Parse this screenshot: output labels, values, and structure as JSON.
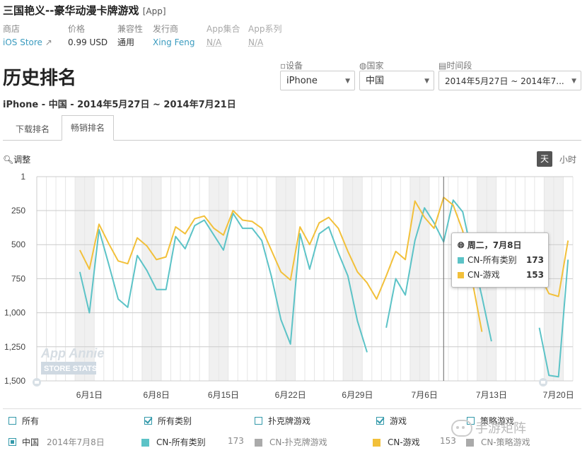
{
  "app": {
    "title": "三国艳义--豪华动漫卡牌游戏",
    "type_tag": "[App]"
  },
  "meta": [
    {
      "key": "商店",
      "value": "iOS Store",
      "link": true,
      "ext": "↗"
    },
    {
      "key": "价格",
      "value": "0.99 USD"
    },
    {
      "key": "兼容性",
      "value": "通用"
    },
    {
      "key": "发行商",
      "value": "Xing Feng",
      "link": true
    },
    {
      "key": "App集合",
      "value": "N/A",
      "na": true
    },
    {
      "key": "App系列",
      "value": "N/A",
      "na": true
    }
  ],
  "page": {
    "heading": "历史排名",
    "subtitle": "iPhone - 中国 - 2014年5月27日 ~ 2014年7月21日"
  },
  "filters": {
    "device": {
      "label": "设备",
      "value": "iPhone"
    },
    "country": {
      "label": "国家",
      "value": "中国"
    },
    "period": {
      "label": "时间段",
      "value": "2014年5月27日 ~ 2014年7..."
    }
  },
  "tabs": [
    {
      "label": "下载排名",
      "active": false
    },
    {
      "label": "畅销排名",
      "active": true
    }
  ],
  "zoom_label": "调整",
  "granularity": {
    "day": "天",
    "hour": "小时"
  },
  "colors": {
    "teal": "#5cc3c7",
    "yellow": "#f2c03a",
    "grid": "#e6e6e6",
    "weekend": "#f0f0f0"
  },
  "watermark_chart": {
    "line1": "App Annie",
    "line2": "STORE STATS"
  },
  "chart_data": {
    "type": "line",
    "y_reversed": true,
    "ylim": [
      1,
      1500
    ],
    "yticks": [
      "1",
      "250",
      "500",
      "750",
      "1,000",
      "1,250",
      "1,500"
    ],
    "x_tick_labels": [
      "6月1日",
      "6月8日",
      "6月15日",
      "6月22日",
      "6月29日",
      "7月6日",
      "7月13日",
      "7月20日"
    ],
    "x": [
      "5/27",
      "5/28",
      "5/29",
      "5/30",
      "5/31",
      "6/1",
      "6/2",
      "6/3",
      "6/4",
      "6/5",
      "6/6",
      "6/7",
      "6/8",
      "6/9",
      "6/10",
      "6/11",
      "6/12",
      "6/13",
      "6/14",
      "6/15",
      "6/16",
      "6/17",
      "6/18",
      "6/19",
      "6/20",
      "6/21",
      "6/22",
      "6/23",
      "6/24",
      "6/25",
      "6/26",
      "6/27",
      "6/28",
      "6/29",
      "6/30",
      "7/1",
      "7/2",
      "7/3",
      "7/4",
      "7/5",
      "7/6",
      "7/7",
      "7/8",
      "7/9",
      "7/10",
      "7/11",
      "7/12",
      "7/13",
      "7/14",
      "7/15",
      "7/16",
      "7/17",
      "7/18",
      "7/19",
      "7/20",
      "7/21"
    ],
    "series": [
      {
        "name": "CN-所有类别",
        "color": "#5cc3c7",
        "values": [
          null,
          null,
          null,
          null,
          700,
          1000,
          390,
          640,
          900,
          960,
          580,
          690,
          830,
          830,
          440,
          530,
          360,
          320,
          430,
          540,
          270,
          380,
          380,
          470,
          730,
          1050,
          1230,
          420,
          680,
          420,
          370,
          560,
          730,
          1060,
          1290,
          null,
          1110,
          750,
          870,
          470,
          230,
          340,
          480,
          173,
          260,
          580,
          880,
          1210,
          null,
          null,
          null,
          null,
          1110,
          1460,
          1470,
          610
        ]
      },
      {
        "name": "CN-游戏",
        "color": "#f2c03a",
        "values": [
          null,
          null,
          null,
          null,
          540,
          680,
          350,
          490,
          620,
          640,
          450,
          510,
          610,
          590,
          370,
          420,
          310,
          290,
          380,
          430,
          250,
          320,
          330,
          380,
          540,
          700,
          760,
          370,
          500,
          340,
          300,
          380,
          550,
          700,
          780,
          900,
          730,
          550,
          610,
          180,
          300,
          380,
          153,
          210,
          400,
          770,
          1140,
          null,
          null,
          null,
          null,
          null,
          720,
          860,
          880,
          470
        ]
      }
    ],
    "tooltip": {
      "title": "周二，7月8日",
      "rows": [
        {
          "name": "CN-所有类别",
          "value": "173"
        },
        {
          "name": "CN-游戏",
          "value": "153"
        }
      ]
    },
    "grid": true
  },
  "legend": {
    "row1": [
      {
        "label": "所有",
        "checked": false
      },
      {
        "label": "所有类别",
        "checked": true
      },
      {
        "label": "扑克牌游戏",
        "checked": false
      },
      {
        "label": "游戏",
        "checked": true
      },
      {
        "label": "策略游戏",
        "checked": false
      }
    ],
    "row2": {
      "country": "中国",
      "date": "2014年7月8日",
      "items": [
        {
          "label": "CN-所有类别",
          "value": "173",
          "color": "#5cc3c7"
        },
        {
          "label": "CN-扑克牌游戏",
          "value": "",
          "color": "#aaaaaa"
        },
        {
          "label": "CN-游戏",
          "value": "153",
          "color": "#f2c03a"
        },
        {
          "label": "CN-策略游戏",
          "value": "",
          "color": "#aaaaaa"
        }
      ]
    }
  },
  "watermark": {
    "text": "手游矩阵"
  }
}
